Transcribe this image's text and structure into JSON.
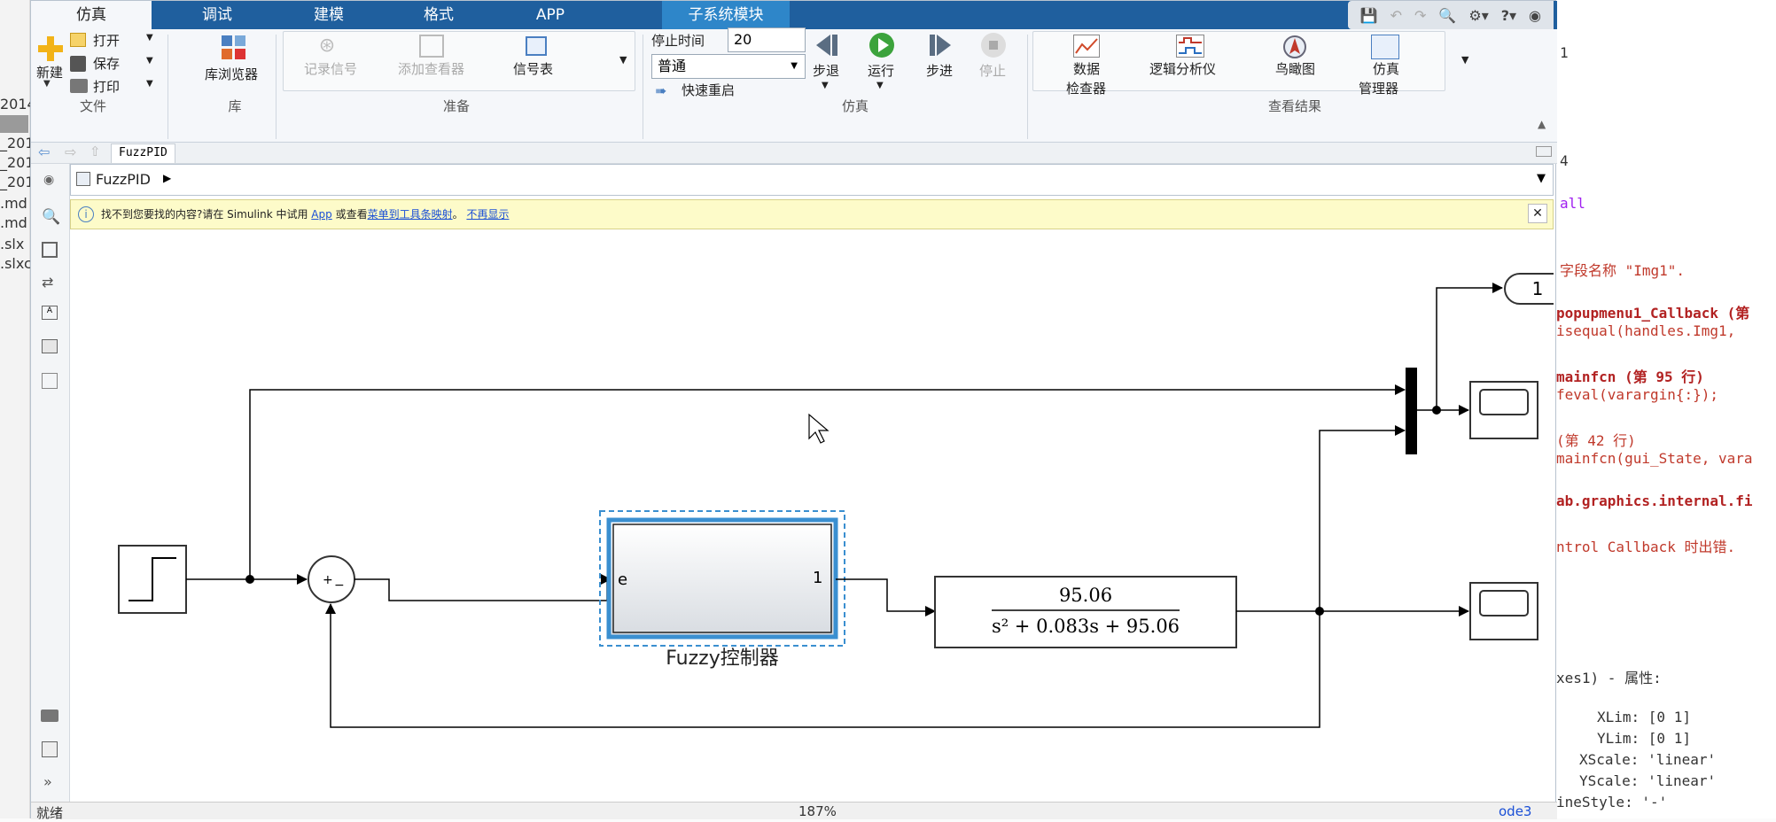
{
  "left_strip": {
    "lines": [
      "2014",
      "_201",
      "_201",
      "_201",
      ".md",
      ".md",
      ".slx",
      ".slxc"
    ]
  },
  "tabs": {
    "sim": "仿真",
    "debug": "调试",
    "model": "建模",
    "format": "格式",
    "app": "APP",
    "subsystem": "子系统模块"
  },
  "ribbon": {
    "file": {
      "new": "新建",
      "open": "打开",
      "save": "保存",
      "print": "打印",
      "group": "文件"
    },
    "library": {
      "browser": "库浏览器",
      "group": "库"
    },
    "prepare": {
      "log_signals": "记录信号",
      "add_viewer": "添加查看器",
      "signal_table": "信号表",
      "group": "准备"
    },
    "simulate": {
      "stop_time_label": "停止时间",
      "stop_time_value": "20",
      "mode": "普通",
      "fast_restart": "快速重启",
      "step_back": "步退",
      "run": "运行",
      "step_forward": "步进",
      "stop": "停止",
      "group": "仿真"
    },
    "results": {
      "data_inspector_1": "数据",
      "data_inspector_2": "检查器",
      "logic_analyzer": "逻辑分析仪",
      "birds_eye": "鸟瞰图",
      "sim_manager_1": "仿真",
      "sim_manager_2": "管理器",
      "group": "查看结果"
    }
  },
  "tab_strip": {
    "model_tab": "FuzzPID"
  },
  "breadcrumb": {
    "model": "FuzzPID"
  },
  "infobar": {
    "text_prefix": "找不到您要找的内容?请在 Simulink 中试用 ",
    "link_app": "App",
    "text_mid": " 或查看",
    "link_mapping": "菜单到工具条映射",
    "text_sep": "。",
    "link_hide": "不再显示"
  },
  "diagram": {
    "sum_signs": "+",
    "sum_minus": "−",
    "subsystem_in": "e",
    "subsystem_out": "1",
    "subsystem_name": "Fuzzy控制器",
    "tf_numerator": "95.06",
    "tf_denominator": "s² + 0.083s + 95.06",
    "outport": "1"
  },
  "status": {
    "ready": "就绪",
    "zoom": "187%",
    "solver": "ode3"
  },
  "editor": {
    "l1": "1",
    "l2": "4",
    "l3": "all",
    "l4": "字段名称 \"Img1\".",
    "l5": "popupmenu1_Callback (第",
    "l6": "  isequal(handles.Img1,",
    "l7": "mainfcn (第 95 行)",
    "l8": "feval(varargin{:});",
    "l9": " (第 42 行)",
    "l10": "mainfcn(gui_State, vara",
    "l11": "ab.graphics.internal.fi",
    "l12": "ntrol Callback 时出错.",
    "l13": "xes1) - 属性:",
    "l14": "XLim: [0 1]",
    "l15": "YLim: [0 1]",
    "l16": "XScale: 'linear'",
    "l17": "YScale: 'linear'",
    "l18": "ineStyle: '-'"
  }
}
